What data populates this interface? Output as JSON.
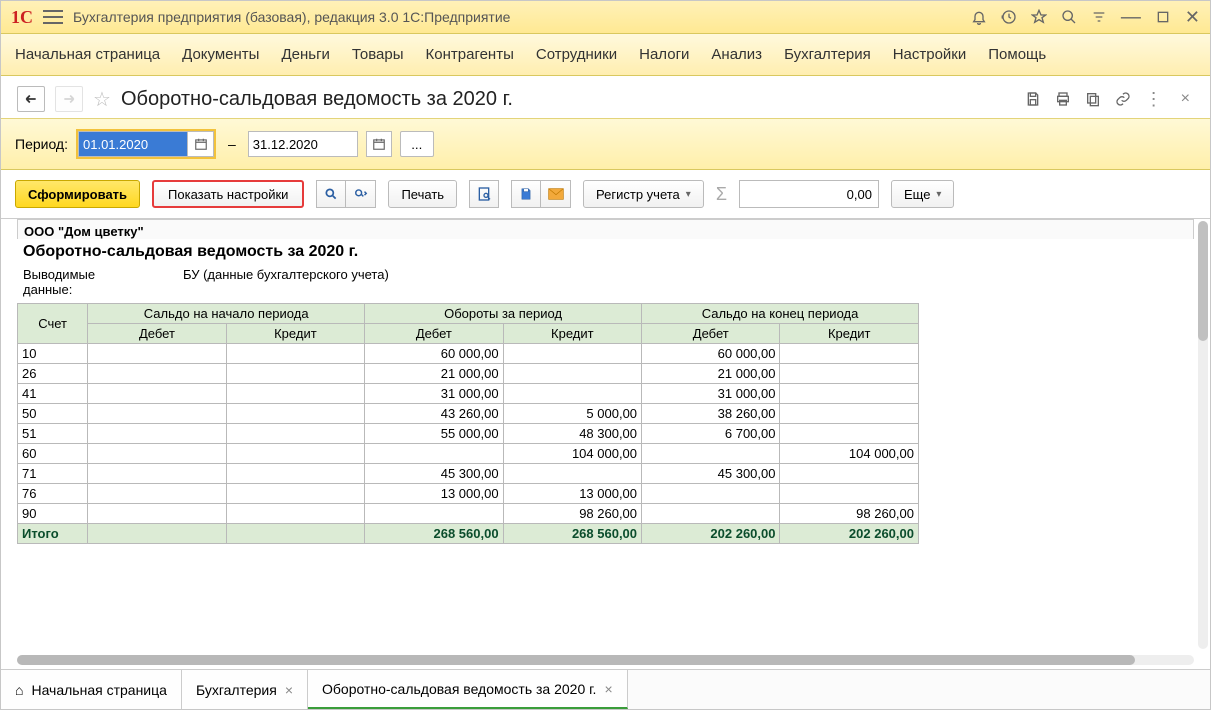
{
  "title": "Бухгалтерия предприятия (базовая), редакция 3.0 1С:Предприятие",
  "menu": [
    "Начальная страница",
    "Документы",
    "Деньги",
    "Товары",
    "Контрагенты",
    "Сотрудники",
    "Налоги",
    "Анализ",
    "Бухгалтерия",
    "Настройки",
    "Помощь"
  ],
  "page": {
    "title": "Оборотно-сальдовая ведомость за 2020 г."
  },
  "period": {
    "label": "Период:",
    "from": "01.01.2020",
    "to": "31.12.2020",
    "ellipsis": "..."
  },
  "actions": {
    "generate": "Сформировать",
    "settings": "Показать настройки",
    "print": "Печать",
    "register": "Регистр учета",
    "more": "Еще",
    "numvalue": "0,00"
  },
  "report": {
    "org": "ООО \"Дом цветку\"",
    "title": "Оборотно-сальдовая ведомость за 2020 г.",
    "outlabel": "Выводимые данные:",
    "outvalue": "БУ (данные бухгалтерского учета)",
    "col_acct": "Счет",
    "col_open": "Сальдо на начало периода",
    "col_turn": "Обороты за период",
    "col_close": "Сальдо на конец периода",
    "col_debit": "Дебет",
    "col_credit": "Кредит",
    "total_label": "Итого",
    "rows": [
      {
        "acct": "10",
        "od": "",
        "oc": "",
        "td": "60 000,00",
        "tc": "",
        "cd": "60 000,00",
        "cc": ""
      },
      {
        "acct": "26",
        "od": "",
        "oc": "",
        "td": "21 000,00",
        "tc": "",
        "cd": "21 000,00",
        "cc": ""
      },
      {
        "acct": "41",
        "od": "",
        "oc": "",
        "td": "31 000,00",
        "tc": "",
        "cd": "31 000,00",
        "cc": ""
      },
      {
        "acct": "50",
        "od": "",
        "oc": "",
        "td": "43 260,00",
        "tc": "5 000,00",
        "cd": "38 260,00",
        "cc": ""
      },
      {
        "acct": "51",
        "od": "",
        "oc": "",
        "td": "55 000,00",
        "tc": "48 300,00",
        "cd": "6 700,00",
        "cc": ""
      },
      {
        "acct": "60",
        "od": "",
        "oc": "",
        "td": "",
        "tc": "104 000,00",
        "cd": "",
        "cc": "104 000,00"
      },
      {
        "acct": "71",
        "od": "",
        "oc": "",
        "td": "45 300,00",
        "tc": "",
        "cd": "45 300,00",
        "cc": ""
      },
      {
        "acct": "76",
        "od": "",
        "oc": "",
        "td": "13 000,00",
        "tc": "13 000,00",
        "cd": "",
        "cc": ""
      },
      {
        "acct": "90",
        "od": "",
        "oc": "",
        "td": "",
        "tc": "98 260,00",
        "cd": "",
        "cc": "98 260,00"
      }
    ],
    "totals": {
      "od": "",
      "oc": "",
      "td": "268 560,00",
      "tc": "268 560,00",
      "cd": "202 260,00",
      "cc": "202 260,00"
    }
  },
  "tabs": {
    "home": "Начальная страница",
    "t1": "Бухгалтерия",
    "t2": "Оборотно-сальдовая ведомость за 2020 г."
  }
}
